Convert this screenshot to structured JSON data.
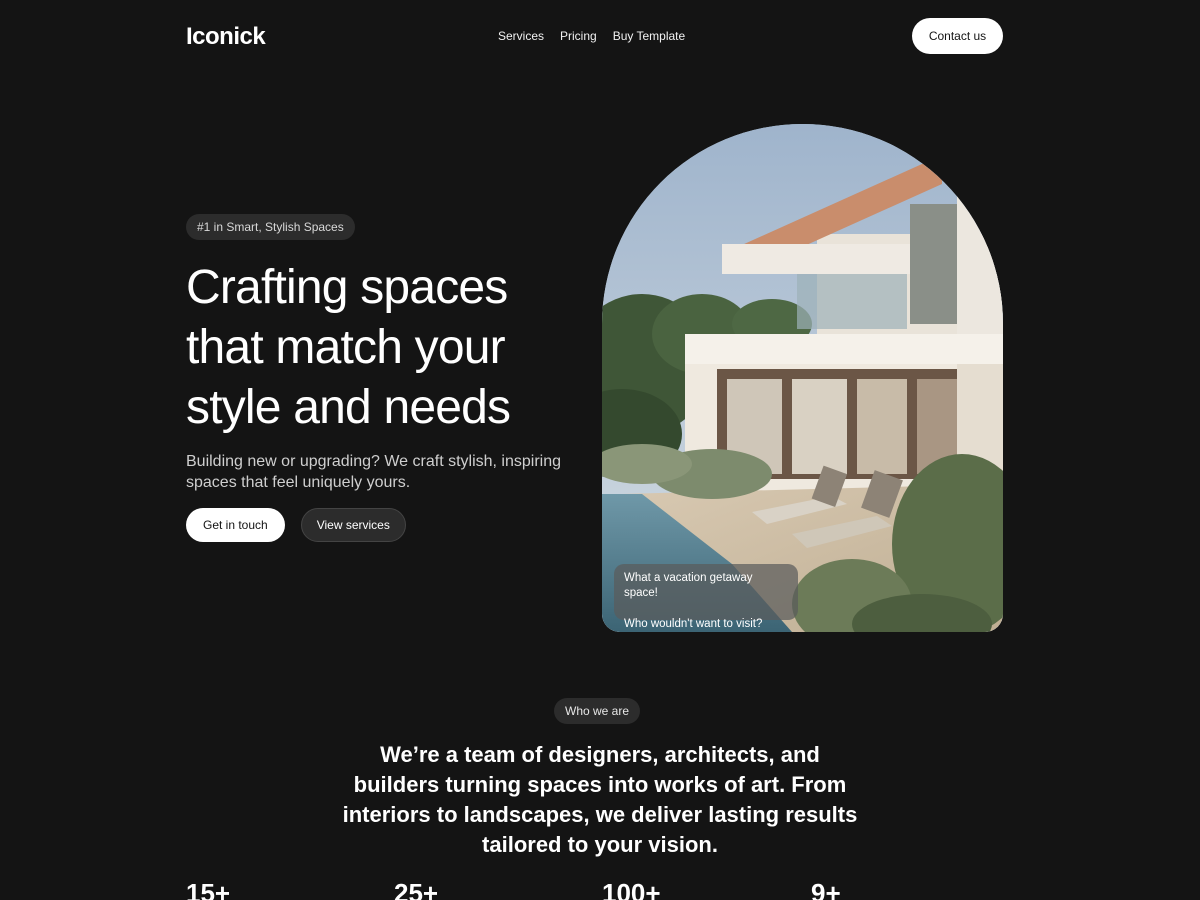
{
  "header": {
    "logo": "Iconick",
    "nav": [
      "Services",
      "Pricing",
      "Buy Template"
    ],
    "contact_label": "Contact us"
  },
  "hero": {
    "badge": "#1 in Smart, Stylish Spaces",
    "title": "Crafting spaces that match your style and needs",
    "subtitle": "Building new or upgrading? We craft stylish, inspiring spaces that feel uniquely yours.",
    "primary_cta": "Get in touch",
    "secondary_cta": "View services",
    "chat": [
      "What a vacation getaway space!",
      "Who wouldn't want to visit?"
    ]
  },
  "about": {
    "pill": "Who we are",
    "text": "We’re a team of designers, architects, and builders turning spaces into works of art. From interiors to landscapes, we deliver lasting results tailored to your vision."
  },
  "stats": [
    "15+",
    "25+",
    "100+",
    "9+"
  ],
  "colors": {
    "background": "#141414",
    "pill_background": "#2c2c2c",
    "button_light": "#ffffff",
    "text_primary": "#ffffff",
    "text_muted": "#cfcfcf"
  }
}
